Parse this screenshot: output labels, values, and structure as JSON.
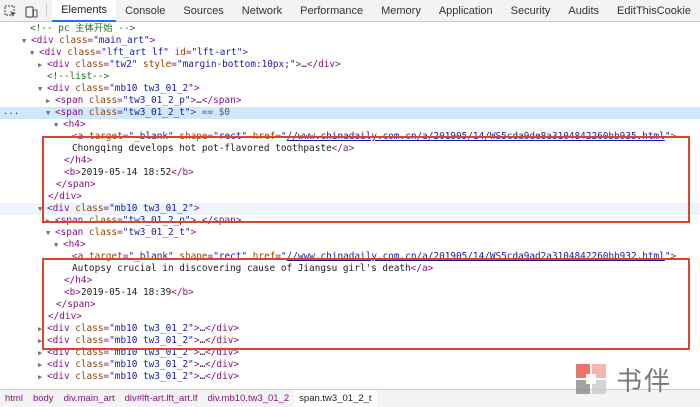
{
  "toolbar": {
    "tabs": [
      {
        "label": "Elements",
        "active": true
      },
      {
        "label": "Console"
      },
      {
        "label": "Sources"
      },
      {
        "label": "Network"
      },
      {
        "label": "Performance"
      },
      {
        "label": "Memory"
      },
      {
        "label": "Application"
      },
      {
        "label": "Security"
      },
      {
        "label": "Audits"
      },
      {
        "label": "EditThisCookie"
      }
    ]
  },
  "tree": {
    "l0": "<!-- pc 主体开始 -->",
    "l1_tag": "div",
    "l1_attr": "class",
    "l1_val": "main_art",
    "l2_tag": "div",
    "l2_attr1": "class",
    "l2_val1": "lft_art lf",
    "l2_attr2": "id",
    "l2_val2": "lft-art",
    "l3_tag": "div",
    "l3_attr1": "class",
    "l3_val1": "tw2",
    "l3_attr2": "style",
    "l3_val2": "margin-bottom:10px;",
    "l3_ellipsis": "…",
    "l4": "<!--list-->",
    "l5_tag": "div",
    "l5_attr": "class",
    "l5_val": "mb10 tw3_01_2",
    "l6_tag": "span",
    "l6_attr": "class",
    "l6_val": "tw3_01_2_p",
    "l6_ellipsis": "…",
    "sel_marker": "...",
    "l7_tag": "span",
    "l7_attr": "class",
    "l7_val": "tw3_01_2_t",
    "l7_eq": " == $0",
    "l8_tag": "h4",
    "l9_tag": "a",
    "l9_attr1": "target",
    "l9_val1": "_blank",
    "l9_attr2": "shape",
    "l9_val2": "rect",
    "l9_attr3": "href",
    "l9_href": "//www.chinadaily.com.cn/a/201905/14/WS5cda9de8a3104842260bb935.html",
    "l10_text": "Chongqing develops hot pot-flavored toothpaste",
    "l11": "</h4>",
    "l12_text": "2019-05-14 18:52",
    "l13": "</span>",
    "l14": "</div>",
    "l15_tag": "div",
    "l15_attr": "class",
    "l15_val": "mb10 tw3_01_2",
    "l16_tag": "span",
    "l16_attr": "class",
    "l16_val": "tw3_01_2_p",
    "l16_ellipsis": "…",
    "l17_tag": "span",
    "l17_attr": "class",
    "l17_val": "tw3_01_2_t",
    "l18_tag": "h4",
    "l19_tag": "a",
    "l19_attr1": "target",
    "l19_val1": "_blank",
    "l19_attr2": "shape",
    "l19_val2": "rect",
    "l19_attr3": "href",
    "l19_href": "//www.chinadaily.com.cn/a/201905/14/WS5cda9ad2a3104842260bb932.html",
    "l20_text": "Autopsy crucial in discovering cause of Jiangsu girl's death",
    "l21": "</h4>",
    "l22_text": "2019-05-14 18:39",
    "l23": "</span>",
    "l24": "</div>",
    "rows_collapsed": [
      {
        "tag": "div",
        "attr": "class",
        "val": "mb10 tw3_01_2",
        "ellipsis": "…"
      },
      {
        "tag": "div",
        "attr": "class",
        "val": "mb10 tw3_01_2",
        "ellipsis": "…"
      },
      {
        "tag": "div",
        "attr": "class",
        "val": "mb10 tw3_01_2",
        "ellipsis": "…"
      },
      {
        "tag": "div",
        "attr": "class",
        "val": "mb10 tw3_01_2",
        "ellipsis": "…"
      },
      {
        "tag": "div",
        "attr": "class",
        "val": "mb10 tw3_01_2",
        "ellipsis": "…"
      }
    ]
  },
  "breadcrumb": [
    {
      "label": "html"
    },
    {
      "label": "body"
    },
    {
      "label": "div.main_art"
    },
    {
      "label": "div#lft-art.lft_art.lf"
    },
    {
      "label": "div.mb10.tw3_01_2"
    },
    {
      "label": "span.tw3_01_2_t",
      "active": true
    }
  ],
  "watermark": {
    "text": "书伴"
  },
  "colors": {
    "selection": "#cfe8fc",
    "highlight_box": "#d9472b",
    "tag": "#881280",
    "attr": "#994500",
    "value": "#1a1aa6"
  }
}
